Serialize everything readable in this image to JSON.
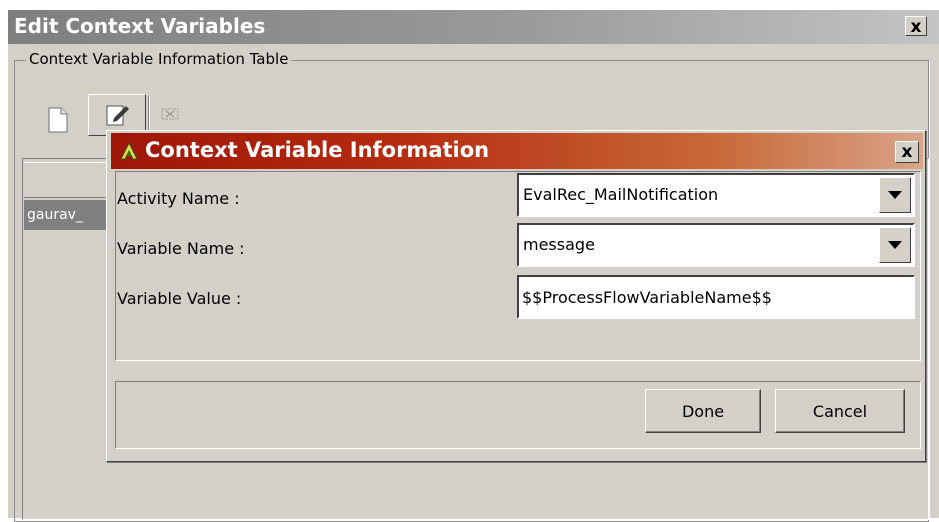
{
  "outer_window": {
    "title": "Edit Context Variables",
    "close_label": "x"
  },
  "group": {
    "legend": "Context Variable Information Table"
  },
  "table": {
    "rows": [
      {
        "first_cell": "gaurav_"
      }
    ]
  },
  "dialog": {
    "title": "Context Variable Information",
    "close_label": "x",
    "fields": {
      "activity_name": {
        "label": "Activity Name :",
        "value": "EvalRec_MailNotification"
      },
      "variable_name": {
        "label": "Variable Name :",
        "value": "message"
      },
      "variable_value": {
        "label": "Variable Value :",
        "value": "$$ProcessFlowVariableName$$"
      }
    },
    "buttons": {
      "done": "Done",
      "cancel": "Cancel"
    }
  },
  "colors": {
    "window_bg": "#d4d0c8",
    "outer_titlebar": "#8a8a8a",
    "dialog_titlebar_start": "#9e1606",
    "dialog_titlebar_end": "#d9a488"
  },
  "icons": {
    "toolbar": [
      "new-document-icon",
      "edit-icon",
      "delete-icon"
    ],
    "dialog_logo": "app-logo-icon",
    "dropdown": "chevron-down-icon"
  }
}
